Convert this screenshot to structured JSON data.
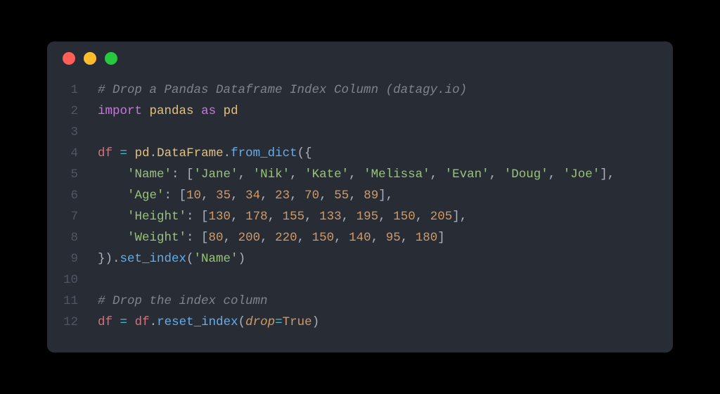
{
  "window": {
    "dots": [
      "red",
      "yellow",
      "green"
    ]
  },
  "colors": {
    "bg": "#282c34",
    "red": "#ff5f56",
    "yellow": "#ffbd2e",
    "green": "#27c93f"
  },
  "code": {
    "lines": [
      [
        {
          "t": "# Drop a Pandas Dataframe Index Column (datagy.io)",
          "c": "comment"
        }
      ],
      [
        {
          "t": "import",
          "c": "keyword"
        },
        {
          "t": " ",
          "c": "default"
        },
        {
          "t": "pandas",
          "c": "module"
        },
        {
          "t": " ",
          "c": "default"
        },
        {
          "t": "as",
          "c": "keyword"
        },
        {
          "t": " ",
          "c": "default"
        },
        {
          "t": "pd",
          "c": "module"
        }
      ],
      [],
      [
        {
          "t": "df",
          "c": "ident"
        },
        {
          "t": " ",
          "c": "default"
        },
        {
          "t": "=",
          "c": "op"
        },
        {
          "t": " ",
          "c": "default"
        },
        {
          "t": "pd",
          "c": "module"
        },
        {
          "t": ".",
          "c": "punc"
        },
        {
          "t": "DataFrame",
          "c": "module"
        },
        {
          "t": ".",
          "c": "punc"
        },
        {
          "t": "from_dict",
          "c": "func"
        },
        {
          "t": "({",
          "c": "punc"
        }
      ],
      [
        {
          "t": "    ",
          "c": "default"
        },
        {
          "t": "'Name'",
          "c": "string"
        },
        {
          "t": ": [",
          "c": "punc"
        },
        {
          "t": "'Jane'",
          "c": "string"
        },
        {
          "t": ", ",
          "c": "punc"
        },
        {
          "t": "'Nik'",
          "c": "string"
        },
        {
          "t": ", ",
          "c": "punc"
        },
        {
          "t": "'Kate'",
          "c": "string"
        },
        {
          "t": ", ",
          "c": "punc"
        },
        {
          "t": "'Melissa'",
          "c": "string"
        },
        {
          "t": ", ",
          "c": "punc"
        },
        {
          "t": "'Evan'",
          "c": "string"
        },
        {
          "t": ", ",
          "c": "punc"
        },
        {
          "t": "'Doug'",
          "c": "string"
        },
        {
          "t": ", ",
          "c": "punc"
        },
        {
          "t": "'Joe'",
          "c": "string"
        },
        {
          "t": "],",
          "c": "punc"
        }
      ],
      [
        {
          "t": "    ",
          "c": "default"
        },
        {
          "t": "'Age'",
          "c": "string"
        },
        {
          "t": ": [",
          "c": "punc"
        },
        {
          "t": "10",
          "c": "number"
        },
        {
          "t": ", ",
          "c": "punc"
        },
        {
          "t": "35",
          "c": "number"
        },
        {
          "t": ", ",
          "c": "punc"
        },
        {
          "t": "34",
          "c": "number"
        },
        {
          "t": ", ",
          "c": "punc"
        },
        {
          "t": "23",
          "c": "number"
        },
        {
          "t": ", ",
          "c": "punc"
        },
        {
          "t": "70",
          "c": "number"
        },
        {
          "t": ", ",
          "c": "punc"
        },
        {
          "t": "55",
          "c": "number"
        },
        {
          "t": ", ",
          "c": "punc"
        },
        {
          "t": "89",
          "c": "number"
        },
        {
          "t": "],",
          "c": "punc"
        }
      ],
      [
        {
          "t": "    ",
          "c": "default"
        },
        {
          "t": "'Height'",
          "c": "string"
        },
        {
          "t": ": [",
          "c": "punc"
        },
        {
          "t": "130",
          "c": "number"
        },
        {
          "t": ", ",
          "c": "punc"
        },
        {
          "t": "178",
          "c": "number"
        },
        {
          "t": ", ",
          "c": "punc"
        },
        {
          "t": "155",
          "c": "number"
        },
        {
          "t": ", ",
          "c": "punc"
        },
        {
          "t": "133",
          "c": "number"
        },
        {
          "t": ", ",
          "c": "punc"
        },
        {
          "t": "195",
          "c": "number"
        },
        {
          "t": ", ",
          "c": "punc"
        },
        {
          "t": "150",
          "c": "number"
        },
        {
          "t": ", ",
          "c": "punc"
        },
        {
          "t": "205",
          "c": "number"
        },
        {
          "t": "],",
          "c": "punc"
        }
      ],
      [
        {
          "t": "    ",
          "c": "default"
        },
        {
          "t": "'Weight'",
          "c": "string"
        },
        {
          "t": ": [",
          "c": "punc"
        },
        {
          "t": "80",
          "c": "number"
        },
        {
          "t": ", ",
          "c": "punc"
        },
        {
          "t": "200",
          "c": "number"
        },
        {
          "t": ", ",
          "c": "punc"
        },
        {
          "t": "220",
          "c": "number"
        },
        {
          "t": ", ",
          "c": "punc"
        },
        {
          "t": "150",
          "c": "number"
        },
        {
          "t": ", ",
          "c": "punc"
        },
        {
          "t": "140",
          "c": "number"
        },
        {
          "t": ", ",
          "c": "punc"
        },
        {
          "t": "95",
          "c": "number"
        },
        {
          "t": ", ",
          "c": "punc"
        },
        {
          "t": "180",
          "c": "number"
        },
        {
          "t": "]",
          "c": "punc"
        }
      ],
      [
        {
          "t": "}).",
          "c": "punc"
        },
        {
          "t": "set_index",
          "c": "func"
        },
        {
          "t": "(",
          "c": "punc"
        },
        {
          "t": "'Name'",
          "c": "string"
        },
        {
          "t": ")",
          "c": "punc"
        }
      ],
      [],
      [
        {
          "t": "# Drop the index column",
          "c": "comment"
        }
      ],
      [
        {
          "t": "df",
          "c": "ident"
        },
        {
          "t": " ",
          "c": "default"
        },
        {
          "t": "=",
          "c": "op"
        },
        {
          "t": " ",
          "c": "default"
        },
        {
          "t": "df",
          "c": "ident"
        },
        {
          "t": ".",
          "c": "punc"
        },
        {
          "t": "reset_index",
          "c": "func"
        },
        {
          "t": "(",
          "c": "punc"
        },
        {
          "t": "drop",
          "c": "param"
        },
        {
          "t": "=",
          "c": "op"
        },
        {
          "t": "True",
          "c": "bool"
        },
        {
          "t": ")",
          "c": "punc"
        }
      ]
    ]
  }
}
